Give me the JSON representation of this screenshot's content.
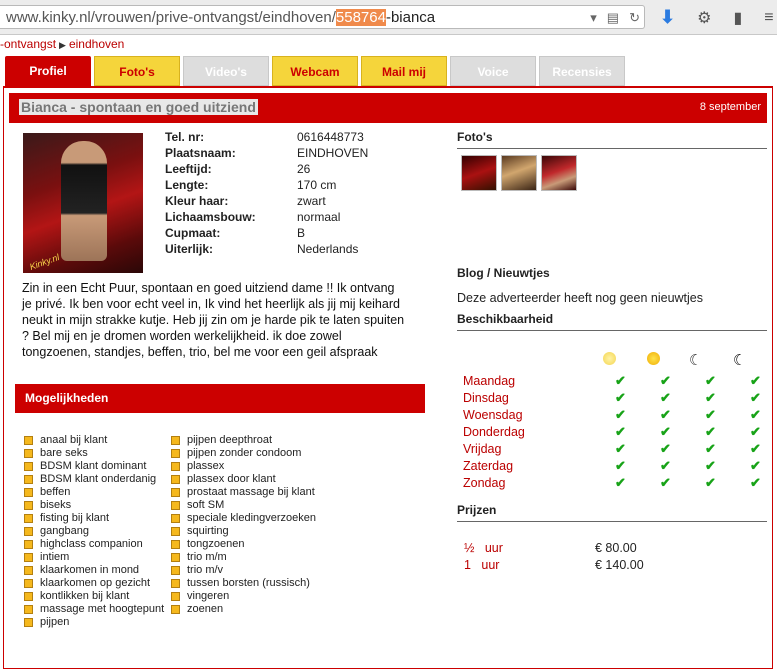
{
  "browser": {
    "url_prefix": "www.kinky.nl/vrouwen/prive-ontvangst/eindhoven/",
    "url_selected": "558764",
    "url_suffix": "-bianca",
    "icons": [
      "reader-icon",
      "reload-icon",
      "download-icon",
      "addon-icon",
      "menu-icon"
    ]
  },
  "breadcrumb": {
    "item1": "-ontvangst",
    "item2": "eindhoven"
  },
  "tabs": [
    {
      "label": "Profiel"
    },
    {
      "label": "Foto's"
    },
    {
      "label": "Video's"
    },
    {
      "label": "Webcam"
    },
    {
      "label": "Mail mij"
    },
    {
      "label": "Voice"
    },
    {
      "label": "Recensies"
    }
  ],
  "profile": {
    "title": "Bianca - spontaan en goed uitziend",
    "date": "8 september",
    "photo_logo": "Kinky.nl",
    "fields": [
      {
        "k": "Tel. nr:",
        "v": "0616448773"
      },
      {
        "k": "Plaatsnaam:",
        "v": "EINDHOVEN"
      },
      {
        "k": "Leeftijd:",
        "v": "26"
      },
      {
        "k": "Lengte:",
        "v": "170 cm"
      },
      {
        "k": "Kleur haar:",
        "v": "zwart"
      },
      {
        "k": "Lichaamsbouw:",
        "v": "normaal"
      },
      {
        "k": "Cupmaat:",
        "v": "B"
      },
      {
        "k": "Uiterlijk:",
        "v": "Nederlands"
      }
    ],
    "description": "Zin in een Echt Puur, spontaan en goed uitziend dame !! Ik ontvang je privé. Ik ben voor echt veel in, Ik vind het heerlijk als jij mij keihard neukt in mijn strakke kutje. Heb jij zin om je harde pik te laten spuiten ? Bel mij en je dromen worden werkelijkheid. ik doe zowel tongzoenen, standjes, beffen, trio, bel me voor een geil afspraak"
  },
  "mogelijkheden": {
    "title": "Mogelijkheden",
    "col1": [
      "anaal bij klant",
      "bare seks",
      "BDSM klant dominant",
      "BDSM klant onderdanig",
      "beffen",
      "biseks",
      "fisting bij klant",
      "gangbang",
      "highclass companion",
      "intiem",
      "klaarkomen in mond",
      "klaarkomen op gezicht",
      "kontlikken bij klant",
      "massage met hoogtepunt",
      "pijpen"
    ],
    "col2": [
      "pijpen deepthroat",
      "pijpen zonder condoom",
      "plassex",
      "plassex door klant",
      "prostaat massage bij klant",
      "soft SM",
      "speciale kledingverzoeken",
      "squirting",
      "tongzoenen",
      "trio m/m",
      "trio m/v",
      "tussen borsten (russisch)",
      "vingeren",
      "zoenen"
    ]
  },
  "right": {
    "photos_title": "Foto's",
    "blog_title": "Blog / Nieuwtjes",
    "blog_text": "Deze adverteerder heeft nog geen nieuwtjes",
    "avail_title": "Beschikbaarheid",
    "days": [
      "Maandag",
      "Dinsdag",
      "Woensdag",
      "Donderdag",
      "Vrijdag",
      "Zaterdag",
      "Zondag"
    ],
    "check": "✔",
    "moon": "☾",
    "prices_title": "Prijzen",
    "prices": [
      {
        "amount": "½",
        "unit": "uur",
        "value": "€ 80.00"
      },
      {
        "amount": "1",
        "unit": "uur",
        "value": "€ 140.00"
      }
    ]
  }
}
